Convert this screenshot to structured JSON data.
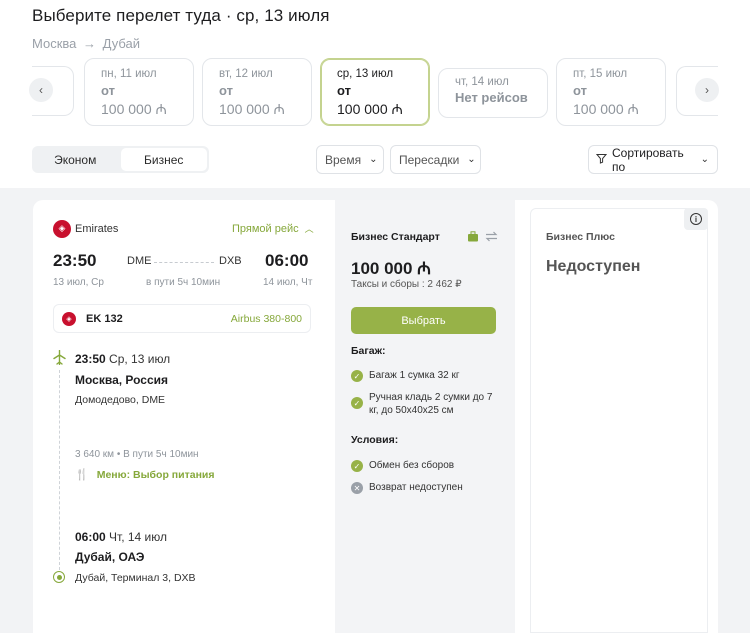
{
  "header": {
    "title": "Выберите перелет туда · ср, 13 июля",
    "route_from": "Москва",
    "route_arrow": "→",
    "route_to": "Дубай"
  },
  "dates": [
    {
      "label": "пн, 11 июл",
      "from": "от",
      "price": "100 000 ₼"
    },
    {
      "label": "вт, 12 июл",
      "from": "от",
      "price": "100 000 ₼"
    },
    {
      "label": "ср, 13 июл",
      "from": "от",
      "price": "100 000 ₼"
    },
    {
      "label": "чт, 14 июл",
      "status": "Нет рейсов"
    },
    {
      "label": "пт, 15 июл",
      "from": "от",
      "price": "100 000 ₼"
    }
  ],
  "filters": {
    "class_economy": "Эконом",
    "class_business": "Бизнес",
    "time": "Время",
    "stops": "Пересадки",
    "sort": "Сортировать по"
  },
  "flight": {
    "airline": "Emirates",
    "direct": "Прямой рейс",
    "dep_time": "23:50",
    "arr_time": "06:00",
    "dep_iata": "DME",
    "arr_iata": "DXB",
    "dep_date": "13 июл, Ср",
    "arr_date": "14 июл, Чт",
    "duration": "в пути 5ч 10мин",
    "flight_no": "EK 132",
    "aircraft": "Airbus 380-800",
    "seg_dep_time": "23:50",
    "seg_dep_day": "Ср, 13 июл",
    "seg_dep_city": "Москва, Россия",
    "seg_dep_apt": "Домодедово, DME",
    "seg_info": "3 640 км • В пути 5ч 10мин",
    "meal": "Меню: Выбор питания",
    "seg_arr_time": "06:00",
    "seg_arr_day": "Чт, 14 июл",
    "seg_arr_city": "Дубай, ОАЭ",
    "seg_arr_apt": "Дубай, Терминал 3, DXB"
  },
  "fare_standard": {
    "title": "Бизнес Стандарт",
    "price": "100 000 ₼",
    "taxes": "Таксы и сборы : 2 462 ₽",
    "select": "Выбрать",
    "baggage_title": "Багаж:",
    "baggage_1": "Багаж 1 сумка 32 кг",
    "baggage_2": "Ручная кладь 2 сумки до 7 кг, до 50x40x25 см",
    "conditions_title": "Условия:",
    "cond_1": "Обмен без сборов",
    "cond_2": "Возврат недоступен"
  },
  "fare_plus": {
    "title": "Бизнес Плюс",
    "status": "Недоступен"
  },
  "colors": {
    "accent": "#97b248",
    "accent_text": "#86a83b",
    "brand_emirates": "#c8102e"
  }
}
